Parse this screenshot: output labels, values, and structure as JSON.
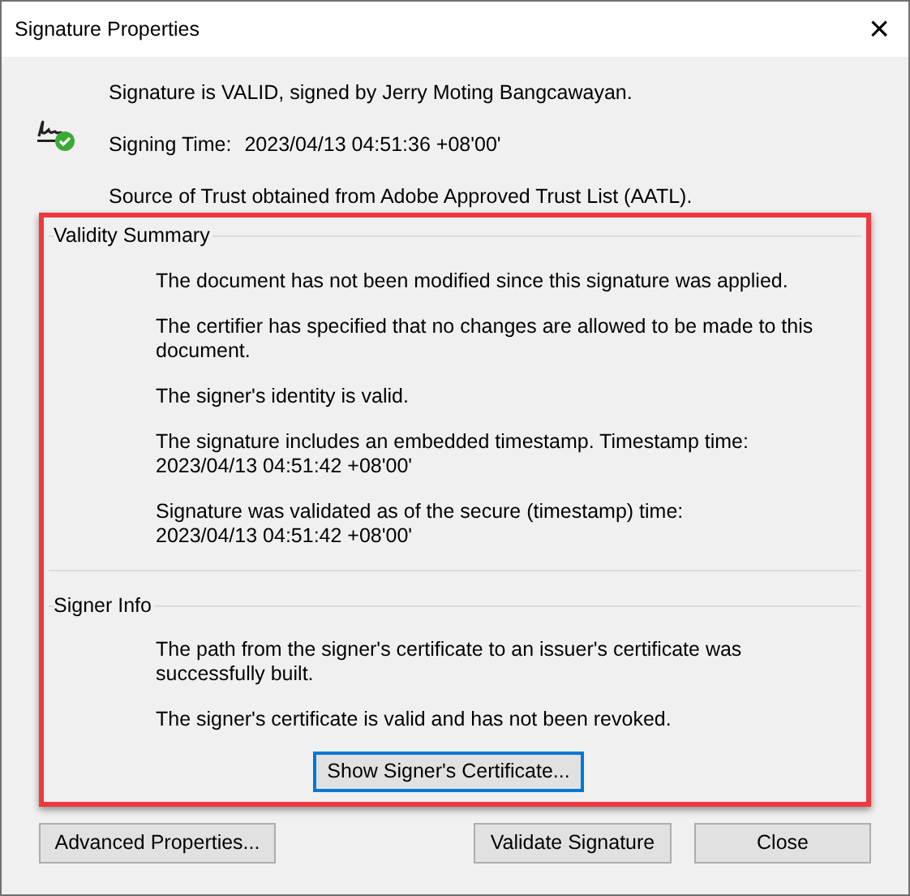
{
  "window": {
    "title": "Signature Properties",
    "close": "×"
  },
  "header": {
    "status": "Signature is VALID, signed by Jerry Moting Bangcawayan.",
    "signing_time_label": "Signing Time:",
    "signing_time": "2023/04/13 04:51:36 +08'00'",
    "trust": "Source of Trust obtained from Adobe Approved Trust List (AATL)."
  },
  "sections": [
    {
      "title": "Validity Summary",
      "lines": [
        "The document has not been modified since this signature was applied.",
        "The certifier has specified that no changes are allowed to be made to this document.",
        "The signer's identity is valid.",
        "The signature includes an embedded timestamp. Timestamp time:\n2023/04/13 04:51:42 +08'00'",
        "Signature was validated as of the secure (timestamp) time:\n2023/04/13 04:51:42 +08'00'"
      ]
    },
    {
      "title": "Signer Info",
      "lines": [
        "The path from the signer's certificate to an issuer's certificate was successfully built.",
        "The signer's certificate is valid and has not been revoked."
      ],
      "button": {
        "label": "Show Signer's Certificate...",
        "focused": true
      }
    }
  ],
  "buttons": [
    {
      "label": "Advanced Properties...",
      "focused": false
    },
    {
      "label": "Validate Signature",
      "focused": false
    },
    {
      "label": "Close",
      "focused": false
    }
  ]
}
